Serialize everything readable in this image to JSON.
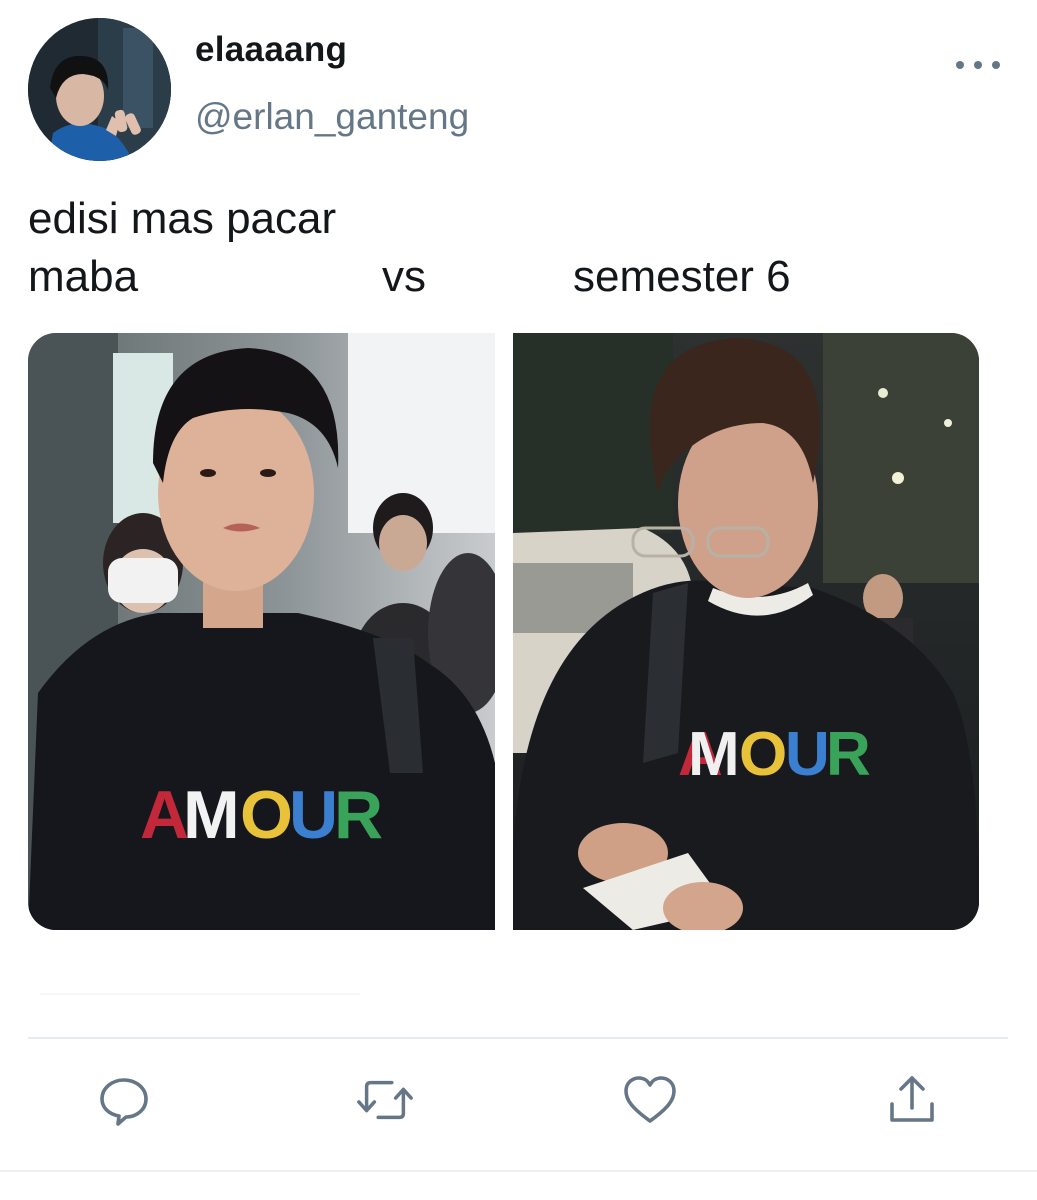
{
  "tweet": {
    "display_name": "elaaaang",
    "handle": "@erlan_ganteng",
    "text_line1": "edisi mas pacar",
    "text_line2": {
      "left": "maba",
      "middle": "vs",
      "right": "semester 6"
    },
    "photos": [
      {
        "shirt_text": "AMOUR"
      },
      {
        "shirt_text": "MOUR"
      }
    ]
  },
  "actions": [
    "reply-icon",
    "retweet-icon",
    "like-icon",
    "share-icon"
  ],
  "colors": {
    "text": "#14171a",
    "secondary": "#657786",
    "divider": "#e6ecf0"
  }
}
